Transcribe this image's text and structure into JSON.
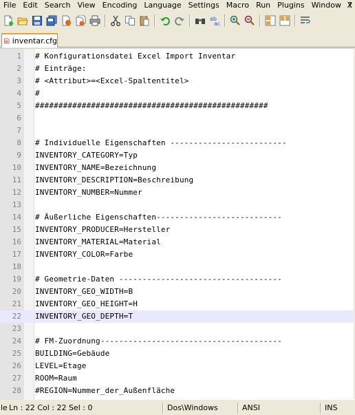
{
  "menu": {
    "items": [
      "File",
      "Edit",
      "Search",
      "View",
      "Encoding",
      "Language",
      "Settings",
      "Macro",
      "Run",
      "Plugins",
      "Window",
      "?"
    ],
    "close": "X"
  },
  "toolbar": {
    "icons": [
      "new-file-icon",
      "open-file-icon",
      "save-icon",
      "save-all-icon",
      "close-icon",
      "close-all-icon",
      "print-icon",
      "cut-icon",
      "copy-icon",
      "paste-icon",
      "undo-icon",
      "redo-icon",
      "find-icon",
      "replace-icon",
      "zoom-in-icon",
      "zoom-out-icon",
      "sync-vertical-icon",
      "sync-horizontal-icon",
      "word-wrap-icon"
    ]
  },
  "tab": {
    "filename": "inventar.cfg",
    "icon": "file-modified-icon"
  },
  "editor": {
    "current_line": 22,
    "lines": [
      "# Konfigurationsdatei Excel Import Inventar",
      "# Einträge:",
      "# <Attribut>=<Excel-Spaltentitel>",
      "#",
      "##################################################",
      "",
      "",
      "# Individuelle Eigenschaften -------------------------",
      "INVENTORY_CATEGORY=Typ",
      "INVENTORY_NAME=Bezeichnung",
      "INVENTORY_DESCRIPTION=Beschreibung",
      "INVENTORY_NUMBER=Nummer",
      "",
      "# Äußerliche Eigenschaften---------------------------",
      "INVENTORY_PRODUCER=Hersteller",
      "INVENTORY_MATERIAL=Material",
      "INVENTORY_COLOR=Farbe",
      "",
      "# Geometrie-Daten -----------------------------------",
      "INVENTORY_GEO_WIDTH=B",
      "INVENTORY_GEO_HEIGHT=H",
      "INVENTORY_GEO_DEPTH=T",
      "",
      "# FM-Zuordnung---------------------------------------",
      "BUILDING=Gebäude",
      "LEVEL=Etage",
      "ROOM=Raum",
      "#REGION=Nummer_der_Außenfläche"
    ]
  },
  "status": {
    "length_prefix": "le",
    "position": "Ln : 22    Col : 22    Sel : 0",
    "eol": "Dos\\Windows",
    "encoding": "ANSI",
    "mode": "INS"
  }
}
